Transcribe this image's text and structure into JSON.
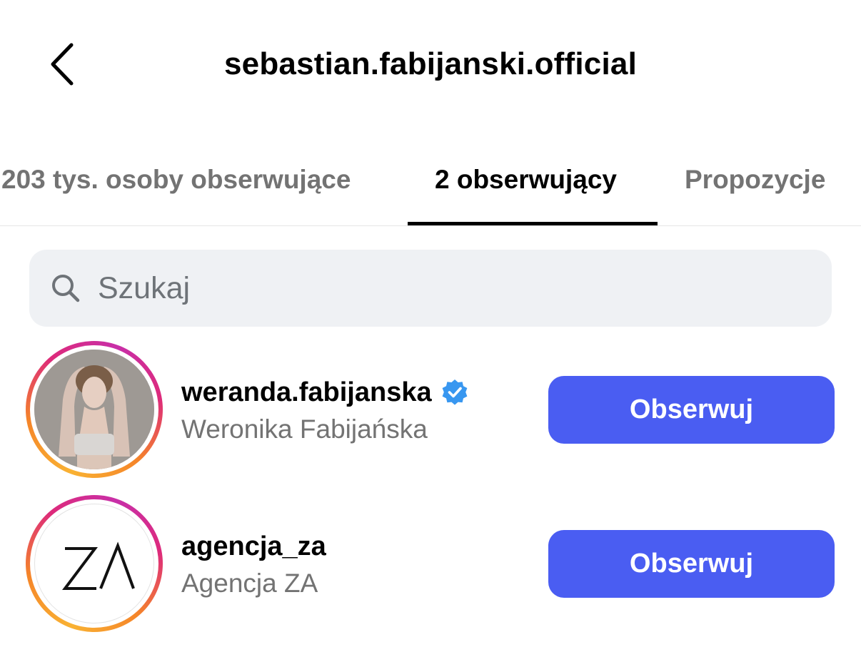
{
  "header": {
    "title": "sebastian.fabijanski.official",
    "back_icon": "chevron-left-icon"
  },
  "tabs": [
    {
      "label": "203 tys. osoby obserwujące",
      "active": false
    },
    {
      "label": "2 obserwujący",
      "active": true
    },
    {
      "label": "Propozycje",
      "active": false
    }
  ],
  "search": {
    "placeholder": "Szukaj",
    "value": "",
    "icon": "search-icon"
  },
  "users": [
    {
      "username": "weranda.fabijanska",
      "full_name": "Weronika Fabijańska",
      "verified": true,
      "avatar": "photo-avatar",
      "button_label": "Obserwuj"
    },
    {
      "username": "agencja_za",
      "full_name": "Agencja ZA",
      "verified": false,
      "avatar": "za-logo-avatar",
      "logo_text": "ZA",
      "button_label": "Obserwuj"
    }
  ],
  "colors": {
    "accent": "#4a5df2",
    "verified": "#3897f0",
    "muted_text": "#737373",
    "search_bg": "#eff1f4"
  }
}
